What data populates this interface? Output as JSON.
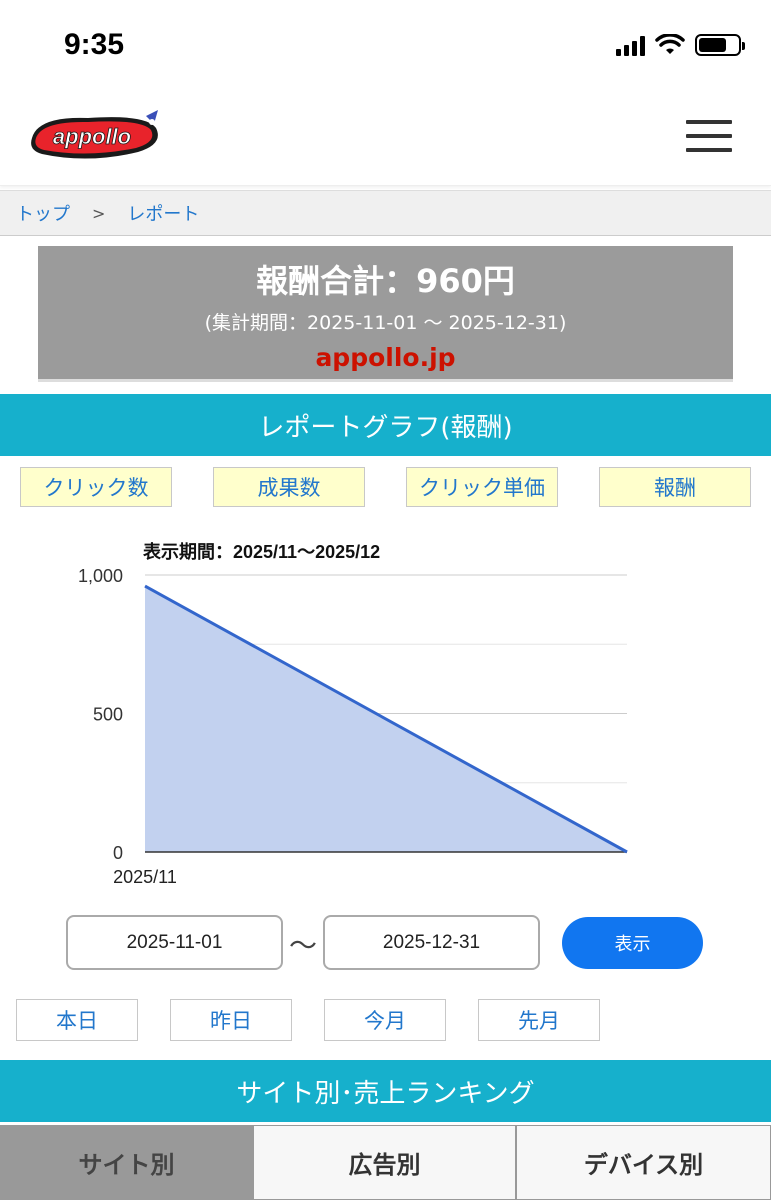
{
  "status_bar": {
    "time": "9:35"
  },
  "header": {
    "logo_text": "appollo"
  },
  "breadcrumb": {
    "items": [
      "トップ",
      "レポート"
    ],
    "separator": ">"
  },
  "summary": {
    "total": "報酬合計：960円",
    "period": "(集計期間：2025-11-01 〜 2025-12-31)",
    "site": "appollo.jp"
  },
  "graph_section": {
    "title": "レポートグラフ(報酬)"
  },
  "metric_buttons": [
    "クリック数",
    "成果数",
    "クリック単価",
    "報酬"
  ],
  "chart_data": {
    "type": "area",
    "title": "表示期間：2025/11〜2025/12",
    "categories": [
      "2025/11",
      "2025/12"
    ],
    "x_tick_labels": [
      "2025/11"
    ],
    "values": [
      960,
      0
    ],
    "ylim": [
      0,
      1000
    ],
    "yticks": [
      "0",
      "500",
      "1,000"
    ],
    "grid": true,
    "line_color": "#3366cc",
    "fill_color": "#c2d1ef"
  },
  "date_range": {
    "from": "2025-11-01",
    "to": "2025-12-31",
    "separator": "〜",
    "submit_label": "表示"
  },
  "quick_ranges": [
    "本日",
    "昨日",
    "今月",
    "先月"
  ],
  "ranking_section": {
    "title": "サイト別･売上ランキング"
  },
  "ranking_tabs": [
    "サイト別",
    "広告別",
    "デバイス別"
  ],
  "colors": {
    "accent": "#16b0cc",
    "link": "#2277cc",
    "button_blue": "#1176f0",
    "highlight_red": "#cc1100"
  }
}
